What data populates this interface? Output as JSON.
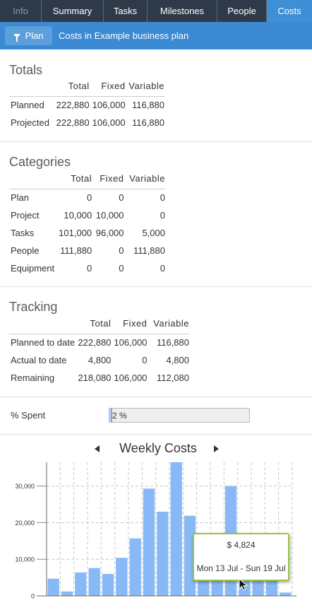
{
  "tabs": [
    {
      "label": "Info",
      "state": "disabled"
    },
    {
      "label": "Summary",
      "state": "normal"
    },
    {
      "label": "Tasks",
      "state": "normal"
    },
    {
      "label": "Milestones",
      "state": "normal"
    },
    {
      "label": "People",
      "state": "normal"
    },
    {
      "label": "Costs",
      "state": "active"
    }
  ],
  "toolbar": {
    "plan_label": "Plan",
    "title": "Costs in Example business plan",
    "filter_icon": "filter-icon"
  },
  "totals": {
    "title": "Totals",
    "headers": [
      "",
      "Total",
      "Fixed",
      "Variable"
    ],
    "rows": [
      [
        "Planned",
        "222,880",
        "106,000",
        "116,880"
      ],
      [
        "Projected",
        "222,880",
        "106,000",
        "116,880"
      ]
    ]
  },
  "categories": {
    "title": "Categories",
    "headers": [
      "",
      "Total",
      "Fixed",
      "Variable"
    ],
    "rows": [
      [
        "Plan",
        "0",
        "0",
        "0"
      ],
      [
        "Project",
        "10,000",
        "10,000",
        "0"
      ],
      [
        "Tasks",
        "101,000",
        "96,000",
        "5,000"
      ],
      [
        "People",
        "111,880",
        "0",
        "111,880"
      ],
      [
        "Equipment",
        "0",
        "0",
        "0"
      ]
    ]
  },
  "tracking": {
    "title": "Tracking",
    "headers": [
      "",
      "Total",
      "Fixed",
      "Variable"
    ],
    "rows": [
      [
        "Planned to date",
        "222,880",
        "106,000",
        "116,880"
      ],
      [
        "Actual to date",
        "4,800",
        "0",
        "4,800"
      ],
      [
        "Remaining",
        "218,080",
        "106,000",
        "112,080"
      ]
    ]
  },
  "spent": {
    "label": "% Spent",
    "value_text": "2 %",
    "fraction": 0.02
  },
  "chart": {
    "title": "Weekly Costs",
    "prev_icon": "chevron-left-icon",
    "next_icon": "chevron-right-icon",
    "tooltip": {
      "value": "$ 4,824",
      "range": "Mon 13 Jul - Sun 19 Jul"
    },
    "cursor_icon": "pointer-cursor-icon"
  },
  "chart_data": {
    "type": "bar",
    "title": "Weekly Costs",
    "xlabel": "",
    "ylabel": "",
    "ylim": [
      0,
      36500
    ],
    "yticks": [
      "0",
      "10,000",
      "20,000",
      "30,000"
    ],
    "ytick_values": [
      0,
      10000,
      20000,
      30000
    ],
    "grid": true,
    "bar_color": "#88b8f5",
    "series": [
      {
        "values": [
          4700,
          1200,
          6400,
          7600,
          6000,
          10400,
          15700,
          29300,
          23000,
          36500,
          21900,
          4824,
          4824,
          30000,
          4824,
          4824,
          5000,
          900
        ]
      }
    ]
  },
  "colors": {
    "tab_bg": "#2e3a4a",
    "active_tab": "#3f8fd6",
    "toolbar": "#3b8ad3",
    "tooltip_border": "#9bc53d"
  }
}
